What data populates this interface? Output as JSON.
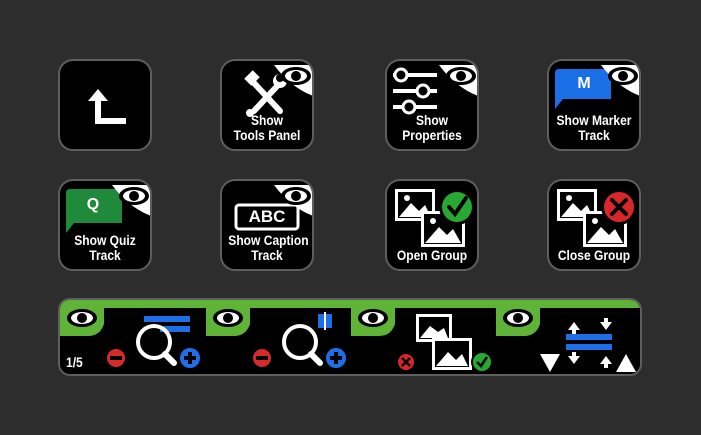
{
  "buttons": [
    {
      "id": "back",
      "lines": []
    },
    {
      "id": "tools",
      "lines": [
        "Show",
        "Tools Panel"
      ]
    },
    {
      "id": "properties",
      "lines": [
        "Show",
        "Properties"
      ]
    },
    {
      "id": "marker",
      "lines": [
        "Show Marker",
        "Track"
      ],
      "badge": "M"
    },
    {
      "id": "quiz",
      "lines": [
        "Show Quiz",
        "Track"
      ],
      "badge": "Q"
    },
    {
      "id": "caption",
      "lines": [
        "Show Caption",
        "Track"
      ],
      "badge": "ABC"
    },
    {
      "id": "open-group",
      "lines": [
        "Open Group"
      ]
    },
    {
      "id": "close-group",
      "lines": [
        "Close Group"
      ]
    }
  ],
  "dial_strip": {
    "page_indicator": "1/5",
    "segments": [
      {
        "id": "zoom-track-height"
      },
      {
        "id": "zoom-timeline"
      },
      {
        "id": "open-close-groups"
      },
      {
        "id": "track-height"
      }
    ]
  },
  "colors": {
    "background": "#2d2d2d",
    "key": "#000000",
    "accent_green": "#5fb337",
    "marker_blue": "#1a6ee6",
    "quiz_green": "#1f8a3a",
    "minus_red": "#d42a2a",
    "plus_blue": "#1e6ee8",
    "check_green": "#26a832",
    "close_red": "#d9262b"
  }
}
